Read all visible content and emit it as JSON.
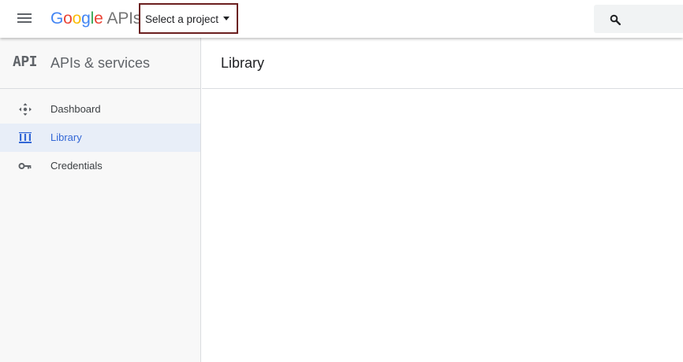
{
  "header": {
    "logo_letters": [
      "G",
      "o",
      "o",
      "g",
      "l",
      "e"
    ],
    "logo_suffix": "APIs",
    "project_select_label": "Select a project",
    "icons": {
      "menu": "hamburger-menu-icon",
      "search": "search-icon",
      "caret": "dropdown-caret-icon"
    }
  },
  "sidebar": {
    "badge": "API",
    "title": "APIs & services",
    "items": [
      {
        "label": "Dashboard",
        "icon": "dashboard-icon",
        "active": false
      },
      {
        "label": "Library",
        "icon": "library-icon",
        "active": true
      },
      {
        "label": "Credentials",
        "icon": "key-icon",
        "active": false
      }
    ]
  },
  "main": {
    "title": "Library"
  },
  "colors": {
    "google_blue": "#4285f4",
    "google_red": "#ea4335",
    "google_yellow": "#fbbc05",
    "google_green": "#34a853",
    "active_blue": "#3367d6",
    "project_border": "#6b1f1f"
  }
}
